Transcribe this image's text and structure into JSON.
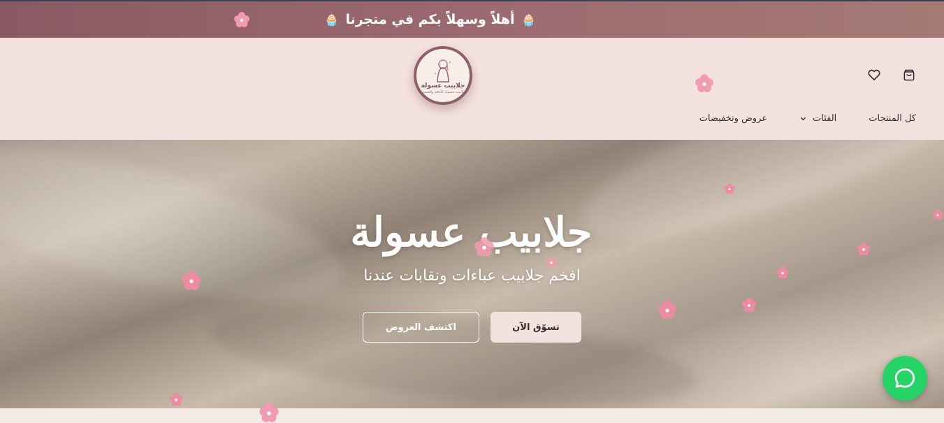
{
  "announcement": {
    "text": "أهلاً وسهلاً بكم في متجرنا",
    "icon": "cupcake-icon"
  },
  "logo": {
    "name": "جلابيب عسولة",
    "tagline": "جلابيب عسولة للأناقة والحشمة"
  },
  "header_icons": {
    "wishlist": "heart-icon",
    "cart": "shopping-bag-icon"
  },
  "nav": {
    "all_products": "كل المنتجات",
    "categories": "الفئات",
    "offers": "عروض وتخفيضات"
  },
  "hero": {
    "title": "جلابيب عسولة",
    "subtitle": "افخم جلابيب عباءات ونقابات عندنا",
    "shop_button": "تسوّق الآن",
    "offers_button": "اكتشف العروض"
  },
  "colors": {
    "accent": "#8a5a64",
    "header_bg": "#f4e2df",
    "whatsapp": "#25d366"
  }
}
